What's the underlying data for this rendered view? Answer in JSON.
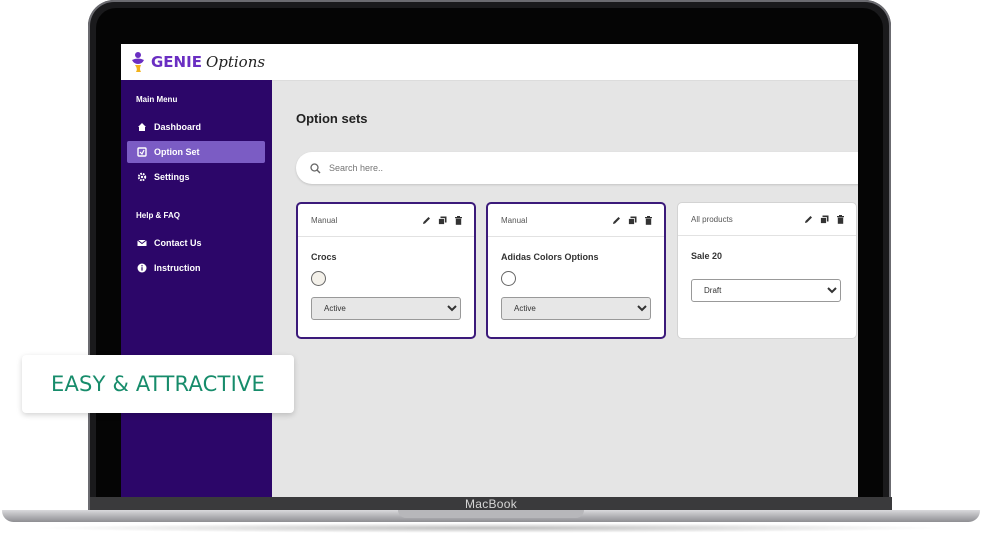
{
  "app": {
    "logo_primary": "GENIE",
    "logo_secondary": "Options",
    "brand_color": "#6a2ec2",
    "sidebar_color": "#2c0669"
  },
  "sidebar": {
    "main_menu_heading": "Main Menu",
    "help_heading": "Help & FAQ",
    "items": [
      {
        "label": "Dashboard",
        "icon": "home-icon",
        "active": false
      },
      {
        "label": "Option Set",
        "icon": "option-set-icon",
        "active": true
      },
      {
        "label": "Settings",
        "icon": "gear-icon",
        "active": false
      },
      {
        "label": "Contact Us",
        "icon": "mail-icon",
        "active": false
      },
      {
        "label": "Instruction",
        "icon": "info-icon",
        "active": false
      }
    ]
  },
  "main": {
    "title": "Option sets",
    "search": {
      "placeholder": "Search here.."
    },
    "cards": [
      {
        "type": "Manual",
        "title": "Crocs",
        "status": "Active",
        "selected": true
      },
      {
        "type": "Manual",
        "title": "Adidas Colors Options",
        "status": "Active",
        "selected": true
      },
      {
        "type": "All products",
        "title": "Sale 20",
        "status": "Draft",
        "selected": false
      }
    ]
  },
  "overlay": {
    "badge_text": "EASY & ATTRACTIVE",
    "badge_color": "#178c6b"
  },
  "device": {
    "brand": "MacBook"
  }
}
